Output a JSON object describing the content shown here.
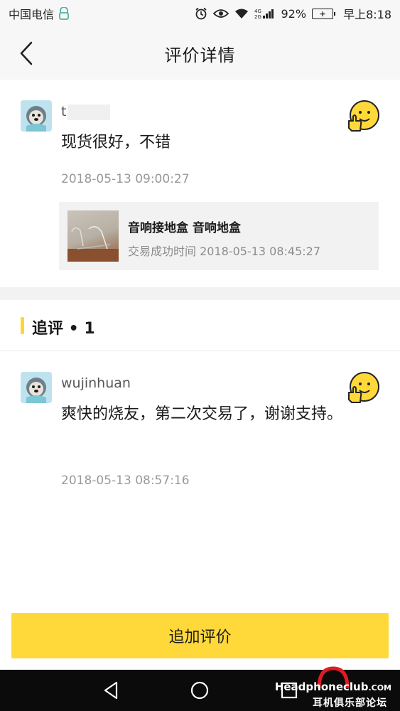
{
  "status_bar": {
    "carrier": "中国电信",
    "battery_percent": "92%",
    "time": "早上8:18",
    "network": "4G"
  },
  "header": {
    "title": "评价详情"
  },
  "main_comment": {
    "username": "t",
    "text": "现货很好，不错",
    "timestamp": "2018-05-13 09:00:27",
    "rating_icon": "thumbs-up-smile-emoji"
  },
  "product": {
    "title": "音响接地盒  音响地盒",
    "meta": "交易成功时间 2018-05-13 08:45:27"
  },
  "followup": {
    "title": "追评 • 1"
  },
  "followup_comment": {
    "username": "wujinhuan",
    "text": "爽快的烧友，第二次交易了，谢谢支持。",
    "timestamp": "2018-05-13 08:57:16",
    "rating_icon": "thumbs-up-smile-emoji"
  },
  "actions": {
    "add_review_label": "追加评价"
  },
  "watermark": {
    "top": "HeadphoneclubCOM",
    "top_main": "Headphoneclub",
    "top_suffix": ".COM",
    "bottom": "耳机俱乐部论坛"
  },
  "colors": {
    "accent": "#ffd93a",
    "background_gray": "#f7f7f7",
    "muted_text": "#999999"
  }
}
